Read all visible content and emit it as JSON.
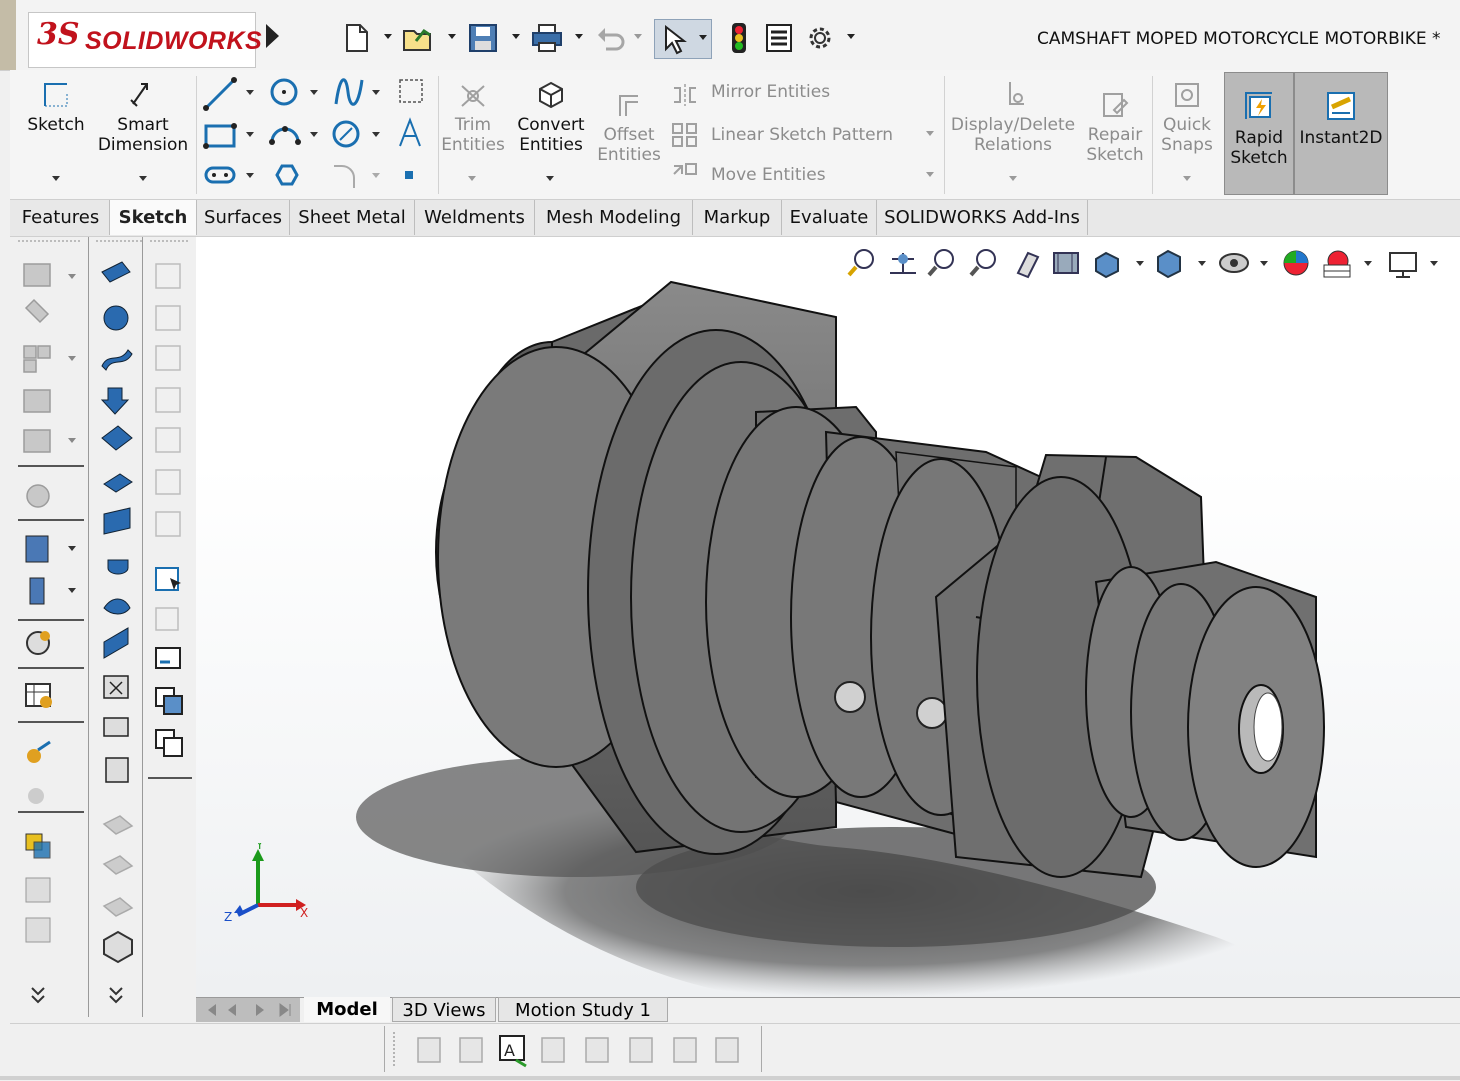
{
  "app": {
    "brand_ds": "3S",
    "brand_text": "SOLIDWORKS",
    "document_title": "CAMSHAFT MOPED MOTORCYCLE MOTORBIKE *"
  },
  "quick_access": [
    {
      "name": "new-document-icon"
    },
    {
      "name": "open-document-icon"
    },
    {
      "name": "save-icon"
    },
    {
      "name": "print-icon"
    },
    {
      "name": "undo-icon"
    },
    {
      "name": "select-cursor-icon"
    },
    {
      "name": "rebuild-traffic-light-icon"
    },
    {
      "name": "file-properties-icon"
    },
    {
      "name": "options-gear-icon"
    }
  ],
  "ribbon": {
    "sketch": "Sketch",
    "smart_dimension": [
      "Smart",
      "Dimension"
    ],
    "trim_entities": [
      "Trim",
      "Entities"
    ],
    "convert_entities": [
      "Convert",
      "Entities"
    ],
    "offset_entities": [
      "Offset",
      "Entities"
    ],
    "mirror_entities": "Mirror Entities",
    "linear_sketch_pattern": "Linear Sketch Pattern",
    "move_entities": "Move Entities",
    "display_delete_relations": [
      "Display/Delete",
      "Relations"
    ],
    "repair_sketch": [
      "Repair",
      "Sketch"
    ],
    "quick_snaps": [
      "Quick",
      "Snaps"
    ],
    "rapid_sketch": [
      "Rapid",
      "Sketch"
    ],
    "instant2d": "Instant2D"
  },
  "tabs": [
    "Features",
    "Sketch",
    "Surfaces",
    "Sheet Metal",
    "Weldments",
    "Mesh Modeling",
    "Markup",
    "Evaluate",
    "SOLIDWORKS Add-Ins"
  ],
  "active_tab": "Sketch",
  "heads_up_toolbar": [
    "zoom-to-fit-icon",
    "zoom-to-area-icon",
    "previous-view-icon",
    "section-view-icon",
    "dynamic-annotation-icon",
    "view-orientation-icon",
    "display-style-icon",
    "hide-show-items-icon",
    "edit-appearance-icon",
    "apply-scene-icon",
    "view-settings-icon"
  ],
  "triad": {
    "x": "X",
    "y": "Y",
    "z": "Z"
  },
  "bottom_tabs": [
    "Model",
    "3D Views",
    "Motion Study 1"
  ],
  "active_bottom_tab": "Model",
  "colors": {
    "brand": "#c1121c",
    "accent": "#1a6fb0",
    "model_gray": "#6a6a6a"
  }
}
